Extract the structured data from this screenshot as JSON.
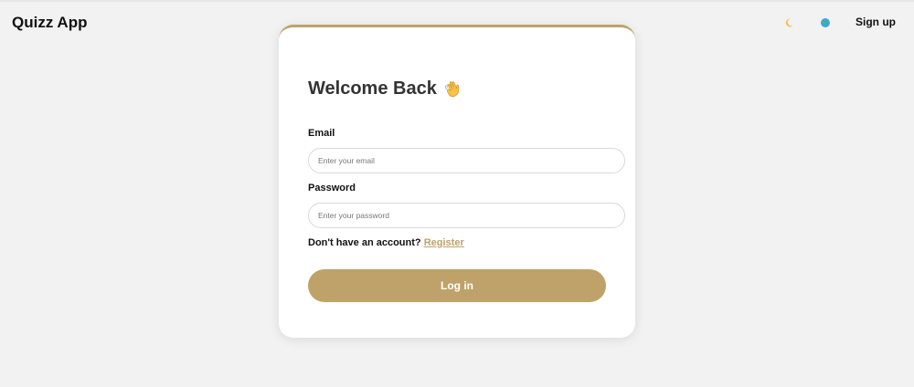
{
  "header": {
    "brand": "Quizz App",
    "signup_label": "Sign up",
    "icons": {
      "theme": "moon-icon",
      "language": "globe-icon"
    }
  },
  "login_card": {
    "title": "Welcome Back",
    "title_icon": "waving-hand-icon",
    "email_label": "Email",
    "email_placeholder": "Enter your email",
    "email_value": "",
    "password_label": "Password",
    "password_placeholder": "Enter your password",
    "password_value": "",
    "account_prompt": "Don't have an account?",
    "register_label": "Register",
    "login_label": "Log in"
  },
  "colors": {
    "accent": "#bfa269",
    "background": "#f2f2f2",
    "card": "#ffffff"
  }
}
